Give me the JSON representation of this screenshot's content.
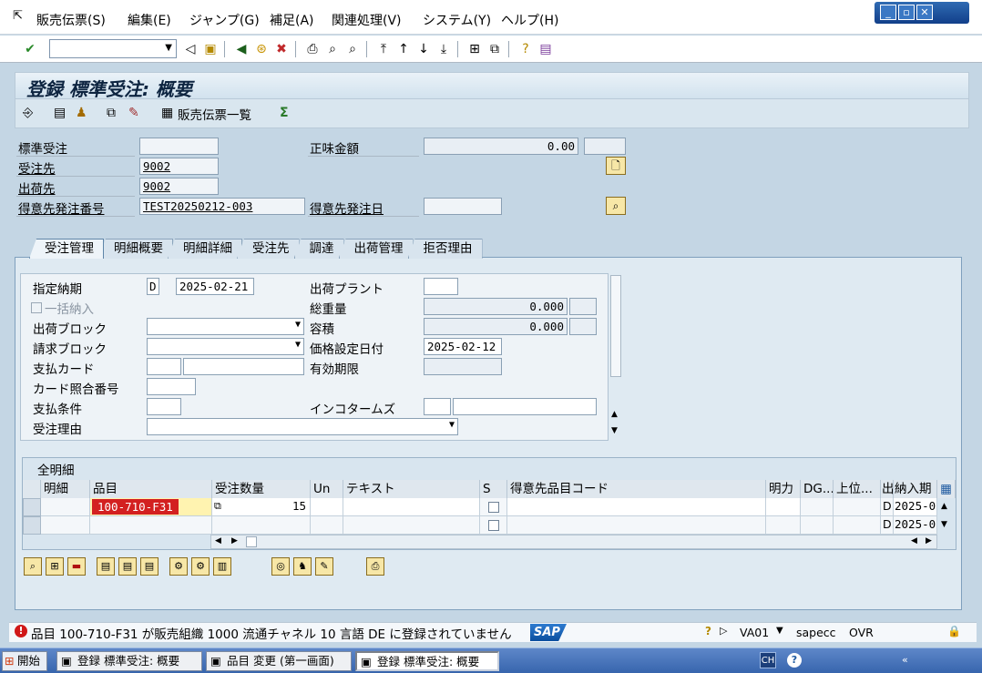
{
  "menu": {
    "items": [
      "販売伝票(S)",
      "編集(E)",
      "ジャンプ(G)",
      "補足(A)",
      "関連処理(V)",
      "システム(Y)",
      "ヘルプ(H)"
    ],
    "window_controls": [
      "_",
      "▫",
      "✕"
    ]
  },
  "toolbar": {
    "command_value": ""
  },
  "title": "登録 標準受注: 概要",
  "app_toolbar": {
    "doc_flow_label": "販売伝票一覧"
  },
  "header": {
    "order_label": "標準受注",
    "order_value": "",
    "soldto_label": "受注先",
    "soldto_value": "9002",
    "shipto_label": "出荷先",
    "shipto_value": "9002",
    "po_label": "得意先発注番号",
    "po_value": "TEST20250212-003",
    "net_label": "正味金額",
    "net_value": "0.00",
    "net_currency": "",
    "po_date_label": "得意先発注日",
    "po_date_value": ""
  },
  "tabs": [
    "受注管理",
    "明細概要",
    "明細詳細",
    "受注先",
    "調達",
    "出荷管理",
    "拒否理由"
  ],
  "sales": {
    "req_date_label": "指定納期",
    "req_date_type": "D",
    "req_date_value": "2025-02-21",
    "complete_dlv_label": "一括納入",
    "delivery_block_label": "出荷ブロック",
    "delivery_block_value": "",
    "billing_block_label": "請求ブロック",
    "billing_block_value": "",
    "payment_card_label": "支払カード",
    "card_verif_label": "カード照合番号",
    "payment_terms_label": "支払条件",
    "order_reason_label": "受注理由",
    "order_reason_value": "",
    "plant_label": "出荷プラント",
    "plant_value": "",
    "weight_label": "総重量",
    "weight_value": "0.000",
    "volume_label": "容積",
    "volume_value": "0.000",
    "pricing_date_label": "価格設定日付",
    "pricing_date_value": "2025-02-12",
    "valid_to_label": "有効期限",
    "valid_to_value": "",
    "incoterms_label": "インコタームズ"
  },
  "items_table": {
    "title": "全明細",
    "columns": [
      "明細",
      "品目",
      "受注数量",
      "Un",
      "テキスト",
      "S",
      "得意先品目コード",
      "明力",
      "DG...",
      "上位...",
      "出",
      "納入期"
    ],
    "rows": [
      {
        "item": "",
        "material": "100-710-F31",
        "qty": "15",
        "un": "",
        "text": "",
        "cust_mat": "",
        "flag": "D",
        "date": "2025-0"
      },
      {
        "item": "",
        "material": "",
        "qty": "",
        "un": "",
        "text": "",
        "cust_mat": "",
        "flag": "D",
        "date": "2025-0"
      }
    ]
  },
  "status": {
    "message": "品目 100-710-F31 が販売組織 1000 流通チャネル 10 言語 DE に登録されていません",
    "sap_logo": "SAP",
    "transaction": "VA01",
    "server": "sapecc",
    "mode": "OVR"
  },
  "taskbar": {
    "start": "開始",
    "tasks": [
      "登録 標準受注: 概要",
      "品目 変更 (第一画面)",
      "登録 標準受注: 概要"
    ],
    "lang": "CH"
  }
}
